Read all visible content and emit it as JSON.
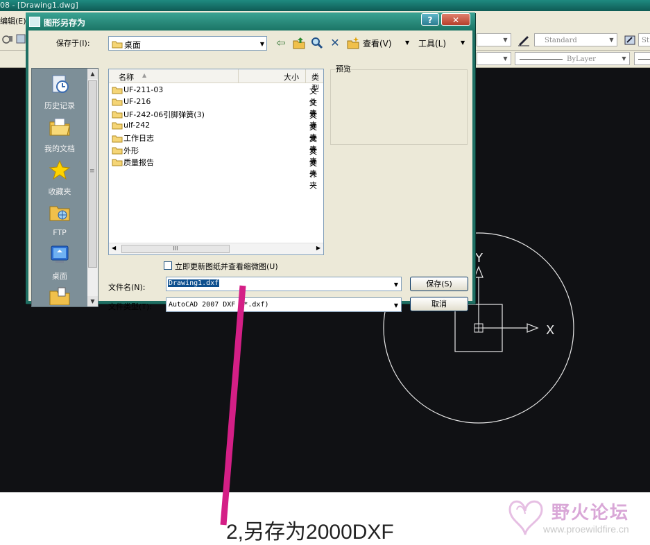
{
  "app": {
    "title": "08 - [Drawing1.dwg]",
    "menu_edit": "编辑(E)",
    "toolbar": {
      "text_style": "Standard",
      "dim_style": "St",
      "linetype": "ByLayer"
    },
    "ucs": {
      "y_label": "Y",
      "x_label": "X"
    }
  },
  "dialog": {
    "title": "图形另存为",
    "help_label": "?",
    "close_label": "✕",
    "save_in_label": "保存于(I):",
    "save_in_value": "桌面",
    "view_menu": "查看(V)",
    "tools_menu": "工具(L)",
    "places": [
      {
        "label": "历史记录",
        "icon": "history-icon"
      },
      {
        "label": "我的文档",
        "icon": "my-documents-icon"
      },
      {
        "label": "收藏夹",
        "icon": "favorites-icon"
      },
      {
        "label": "FTP",
        "icon": "ftp-icon"
      },
      {
        "label": "桌面",
        "icon": "desktop-icon"
      }
    ],
    "columns": {
      "name": "名称",
      "size": "大小",
      "type": "类型"
    },
    "files": [
      {
        "name": "UF-211-03",
        "type": "文件夹"
      },
      {
        "name": "UF-216",
        "type": "文件夹"
      },
      {
        "name": "UF-242-06引脚弹簧(3)",
        "type": "文件夹"
      },
      {
        "name": "ulf-242",
        "type": "文件夹"
      },
      {
        "name": "工作日志",
        "type": "文件夹"
      },
      {
        "name": "外形",
        "type": "文件夹"
      },
      {
        "name": "质量报告",
        "type": "文件夹"
      }
    ],
    "preview_label": "预览",
    "thumbnail_checkbox": "立即更新图纸并查看缩微图(U)",
    "filename_label": "文件名(N):",
    "filename_value": "Drawing1.dxf",
    "filetype_label": "文件类型(T):",
    "filetype_value": "AutoCAD 2007 DXF (*.dxf)",
    "save_button": "保存(S)",
    "cancel_button": "取消"
  },
  "annotation": {
    "caption": "2,另存为2000DXF",
    "arrow_color": "#d41f86"
  },
  "watermark": {
    "name": "野火论坛",
    "url": "www.proewildfire.cn"
  }
}
